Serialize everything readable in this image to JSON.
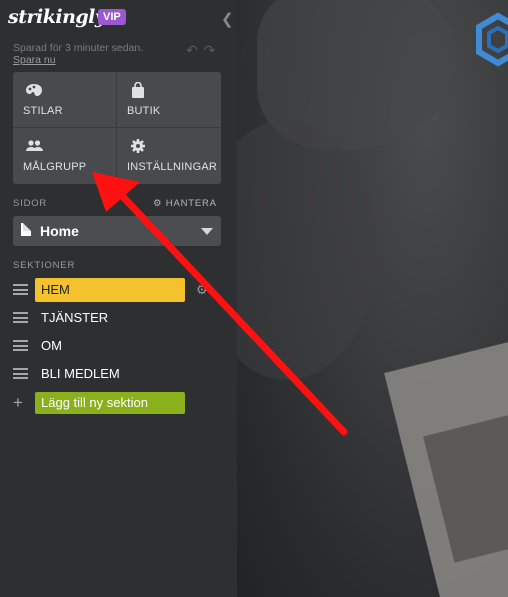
{
  "app": {
    "logo": "strikingly",
    "badge": "VIP"
  },
  "status": {
    "saved_text": "Sparad för 3 minuter sedan.",
    "save_link": "Spara nu"
  },
  "tiles": [
    {
      "label": "STILAR",
      "icon": "palette-icon"
    },
    {
      "label": "BUTIK",
      "icon": "shopping-bag-icon"
    },
    {
      "label": "MÅLGRUPP",
      "icon": "users-icon"
    },
    {
      "label": "INSTÄLLNINGAR",
      "icon": "gear-icon"
    }
  ],
  "pages": {
    "heading": "SIDOR",
    "manage_label": "HANTERA",
    "selected": "Home"
  },
  "sections": {
    "heading": "SEKTIONER",
    "items": [
      "HEM",
      "TJÄNSTER",
      "OM",
      "BLI MEDLEM"
    ],
    "active_index": 0,
    "add_label": "Lägg till ny sektion"
  },
  "colors": {
    "active_section": "#f4c12f",
    "add_button": "#8ab11c",
    "vip_badge": "#9b59d0",
    "annotation_arrow": "#ff1111"
  }
}
